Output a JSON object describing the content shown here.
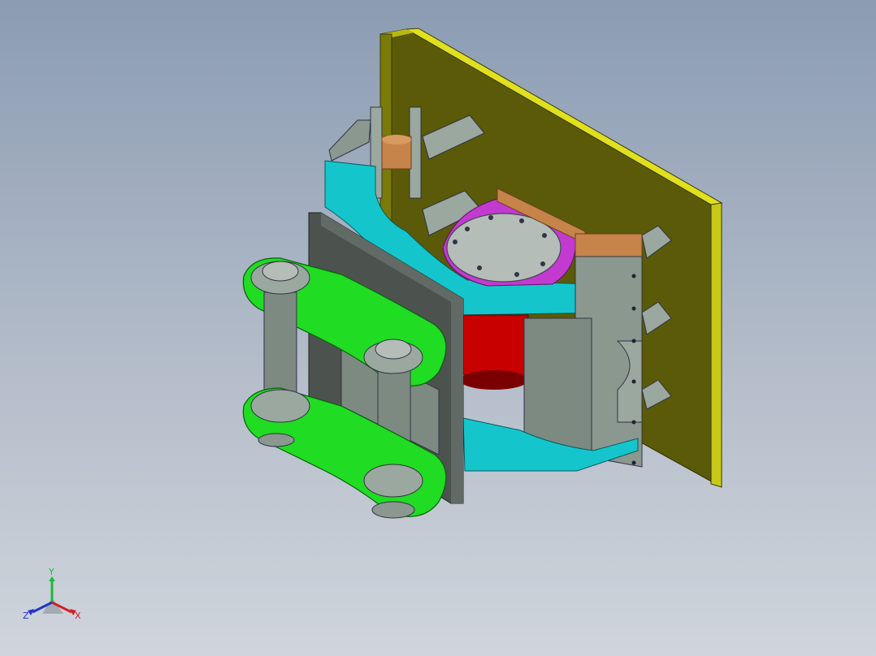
{
  "triad": {
    "x_label": "X",
    "y_label": "Y",
    "z_label": "Z",
    "x_color": "#d2202a",
    "y_color": "#1fb83a",
    "z_color": "#2236c8"
  },
  "colors": {
    "background_top": "#8b9cb3",
    "background_bottom": "#d0d5dc",
    "back_plate": "#5a5a08",
    "back_plate_edge": "#e2e21a",
    "bracket": "#14c6cc",
    "link_plate": "#20dc22",
    "rotator_body": "#c80000",
    "rotator_flange": "#c23ad0",
    "copper_tube": "#c6844a",
    "steel_grey": "#8a9890",
    "dark_plate": "#4c534e"
  }
}
